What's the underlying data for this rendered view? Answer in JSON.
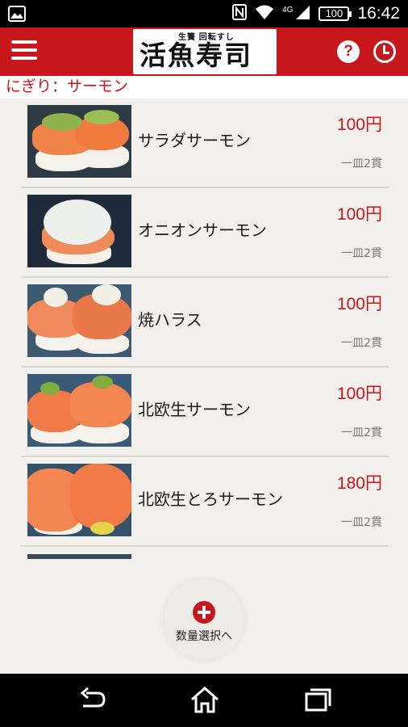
{
  "status_bar": {
    "time": "16:42",
    "network": "4G",
    "battery": "100"
  },
  "header": {
    "logo_sub": "生簀 回転すし",
    "logo_main": "活魚寿司",
    "help_label": "?"
  },
  "category": {
    "title": "にぎり：サーモン"
  },
  "items": [
    {
      "name": "サラダサーモン",
      "price": "100円",
      "unit": "一皿2貫"
    },
    {
      "name": "オニオンサーモン",
      "price": "100円",
      "unit": "一皿2貫"
    },
    {
      "name": "焼ハラス",
      "price": "100円",
      "unit": "一皿2貫"
    },
    {
      "name": "北欧生サーモン",
      "price": "100円",
      "unit": "一皿2貫"
    },
    {
      "name": "北欧生とろサーモン",
      "price": "180円",
      "unit": "一皿2貫"
    }
  ],
  "fab": {
    "label": "数量選択へ"
  },
  "icons": {
    "menu": "hamburger-menu-icon",
    "help": "question-icon",
    "clock": "clock-icon",
    "back": "back-arrow-icon",
    "home": "home-icon",
    "recents": "recent-apps-icon"
  },
  "colors": {
    "brand_red": "#c8161d",
    "background": "#f1f0ec"
  }
}
